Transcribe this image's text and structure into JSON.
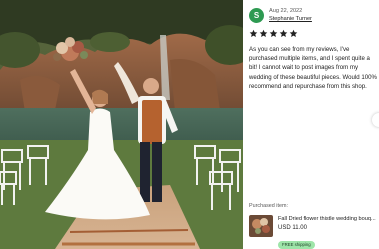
{
  "review": {
    "avatar_initial": "S",
    "date": "Aug 22, 2022",
    "reviewer_name": "Stephanie Turner",
    "rating": 5,
    "text": "As you can see from my reviews, I've purchased multiple items, and I spent quite a bit! I cannot wait to post images from my wedding of these beautiful pieces. Would 100% recommend and repurchase from this shop."
  },
  "purchase": {
    "label": "Purchased item:",
    "product_title": "Fall Dried flower thistle wedding bouq...",
    "price": "USD 11.00",
    "shipping_badge": "FREE shipping"
  },
  "colors": {
    "avatar": "#2e9a52",
    "shipping_badge": "#9ee5a9",
    "star": "#222222"
  },
  "icons": [
    "star-icon",
    "chevron-right-icon"
  ]
}
